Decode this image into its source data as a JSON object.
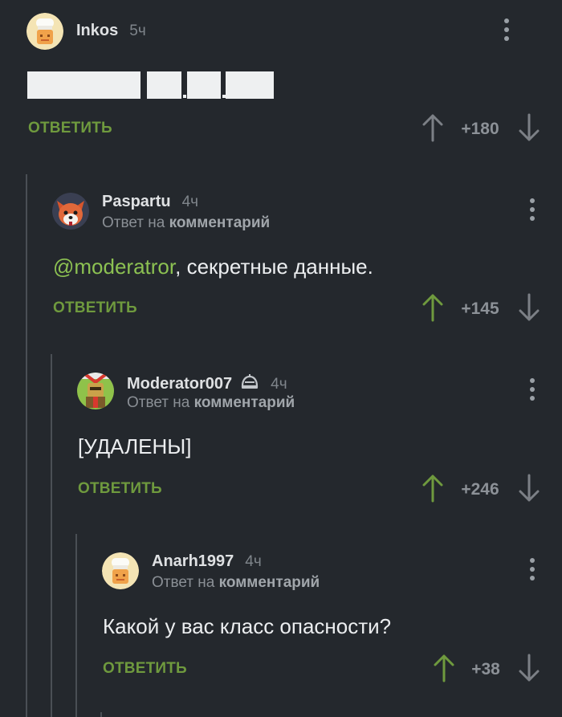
{
  "comments": [
    {
      "username": "Inkos",
      "time": "5ч",
      "avatar": "chef-avatar",
      "text_redacted": true,
      "reply_label": "ОТВЕТИТЬ",
      "rating": "+180",
      "upvote_color": "#7c8086"
    },
    {
      "username": "Paspartu",
      "time": "4ч",
      "avatar": "fox-avatar",
      "reply_prefix": "Ответ на",
      "reply_target": "комментарий",
      "mention": "@moderatror",
      "text": ", секретные данные.",
      "reply_label": "ОТВЕТИТЬ",
      "rating": "+145",
      "upvote_color": "#6f9a3e"
    },
    {
      "username": "Moderator007",
      "time": "4ч",
      "avatar": "knight-avatar",
      "badge": "moderator-helmet-icon",
      "reply_prefix": "Ответ на",
      "reply_target": "комментарий",
      "text": "[УДАЛЕНЫ]",
      "reply_label": "ОТВЕТИТЬ",
      "rating": "+246",
      "upvote_color": "#6f9a3e"
    },
    {
      "username": "Anarh1997",
      "time": "4ч",
      "avatar": "chef-avatar",
      "reply_prefix": "Ответ на",
      "reply_target": "комментарий",
      "text": "Какой у вас класс опасности?",
      "reply_label": "ОТВЕТИТЬ",
      "rating": "+38",
      "upvote_color": "#6f9a3e"
    }
  ],
  "colors": {
    "background": "#24282d",
    "accent_green": "#6f9a3e",
    "mention_green": "#8cc152",
    "thread_line": "#4a4f55"
  }
}
